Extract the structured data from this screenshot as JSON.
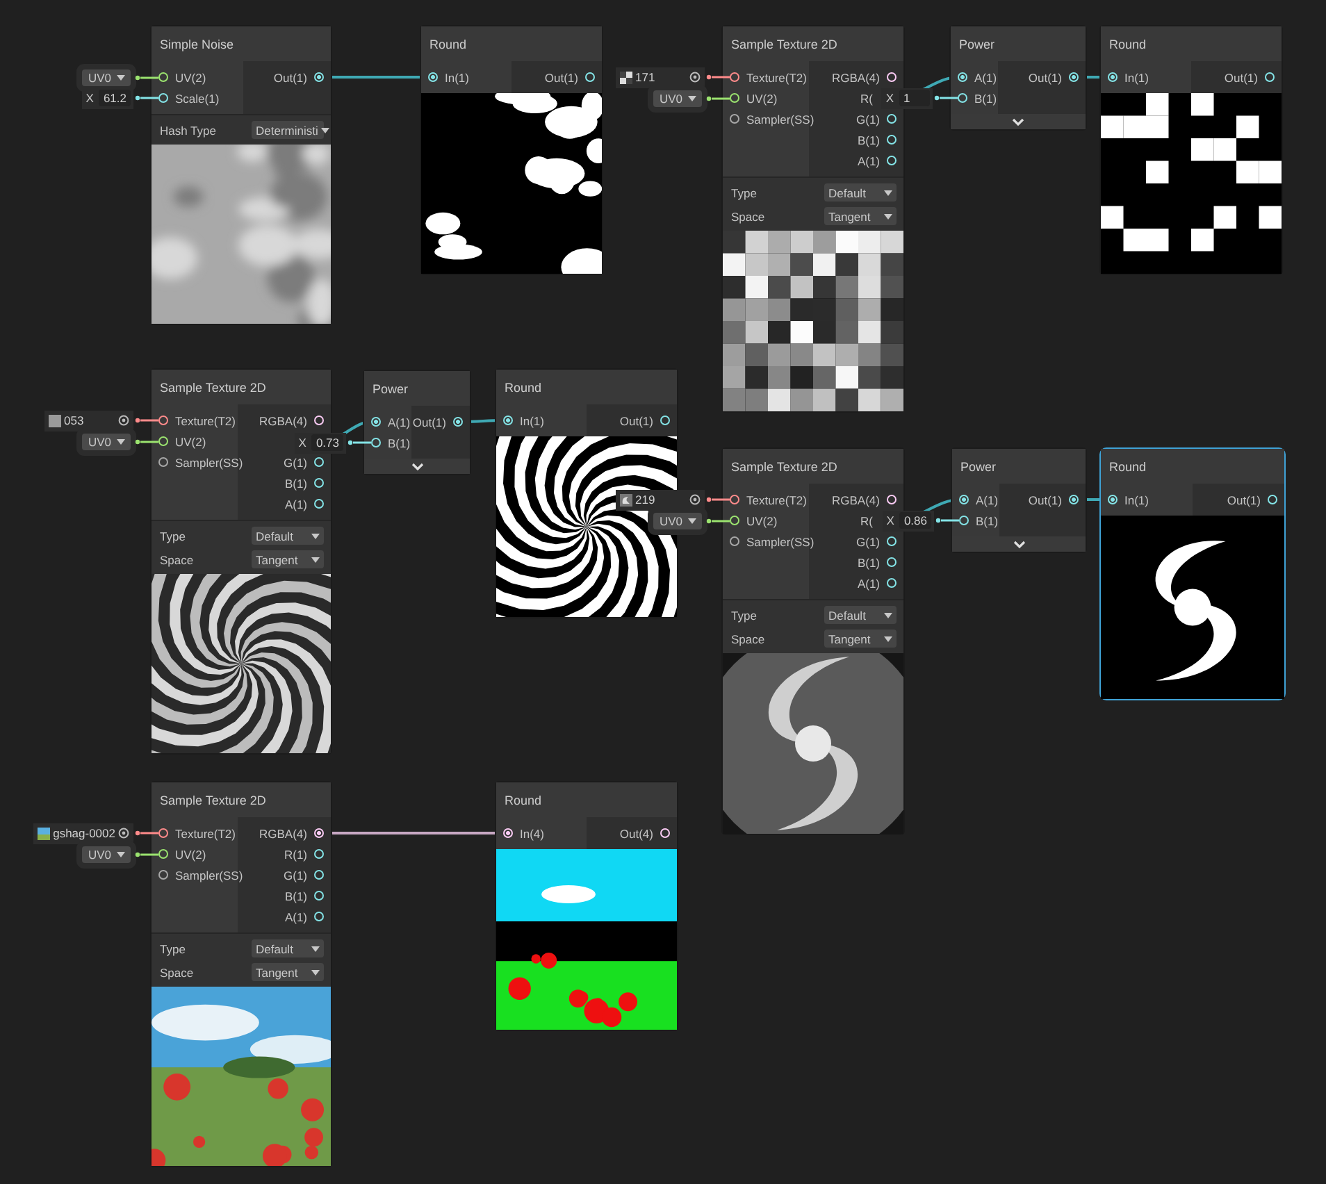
{
  "nodes": [
    {
      "kind": "noise",
      "title": "Simple Noise",
      "selected": false,
      "inputs": [
        {
          "label": "UV(2)",
          "color": "#9be36f",
          "connected": false,
          "field": {
            "kind": "dropdown",
            "value": "UV0"
          }
        },
        {
          "label": "Scale(1)",
          "color": "#84e4e7",
          "connected": false,
          "field": {
            "kind": "vector",
            "axis": "X",
            "value": "61.2"
          }
        }
      ],
      "outputs": [
        {
          "label": "Out(1)",
          "color": "#84e4e7",
          "connected": true
        }
      ],
      "settings": [
        {
          "label": "Hash Type",
          "value": "Deterministi"
        }
      ],
      "preview": {
        "kind": "picture"
      }
    },
    {
      "kind": "round",
      "title": "Round",
      "selected": false,
      "inputs": [
        {
          "label": "In(1)",
          "color": "#84e4e7",
          "connected": true
        }
      ],
      "outputs": [
        {
          "label": "Out(1)",
          "color": "#84e4e7",
          "connected": false
        }
      ],
      "preview": {
        "kind": "picture"
      }
    },
    {
      "kind": "sample",
      "title": "Sample Texture 2D",
      "selected": false,
      "inputs": [
        {
          "label": "Texture(T2)",
          "color": "#ff8b8b",
          "connected": false,
          "field": {
            "kind": "texture",
            "value": "171"
          }
        },
        {
          "label": "UV(2)",
          "color": "#9be36f",
          "connected": false,
          "field": {
            "kind": "dropdown",
            "value": "UV0"
          }
        },
        {
          "label": "Sampler(SS)",
          "color": "#a8a8a8",
          "connected": false
        }
      ],
      "outputs": [
        {
          "kind": "port",
          "label": "RGBA(4)",
          "color": "#fbcbf4",
          "connected": false
        },
        {
          "kind": "covered",
          "label": "R("
        },
        {
          "kind": "port",
          "label": "G(1)",
          "color": "#84e4e7",
          "connected": false
        },
        {
          "kind": "port",
          "label": "B(1)",
          "color": "#84e4e7",
          "connected": false
        },
        {
          "kind": "port",
          "label": "A(1)",
          "color": "#84e4e7",
          "connected": false
        }
      ],
      "settings": [
        {
          "label": "Type",
          "value": "Default"
        },
        {
          "label": "Space",
          "value": "Tangent"
        }
      ],
      "preview": {
        "kind": "picture"
      }
    },
    {
      "kind": "power",
      "title": "Power",
      "selected": false,
      "inputs": [
        {
          "label": "A(1)",
          "color": "#84e4e7",
          "connected": true
        },
        {
          "label": "B(1)",
          "color": "#84e4e7",
          "connected": false,
          "field": {
            "kind": "vector",
            "axis": "X",
            "value": "1"
          }
        }
      ],
      "outputs": [
        {
          "label": "Out(1)",
          "color": "#84e4e7",
          "connected": true
        }
      ],
      "expanded": false
    },
    {
      "kind": "round",
      "title": "Round",
      "selected": false,
      "inputs": [
        {
          "label": "In(1)",
          "color": "#84e4e7",
          "connected": true
        }
      ],
      "outputs": [
        {
          "label": "Out(1)",
          "color": "#84e4e7",
          "connected": false
        }
      ],
      "preview": {
        "kind": "picture"
      }
    },
    {
      "kind": "sample",
      "title": "Sample Texture 2D",
      "selected": false,
      "inputs": [
        {
          "label": "Texture(T2)",
          "color": "#ff8b8b",
          "connected": false,
          "field": {
            "kind": "texture",
            "value": "053"
          }
        },
        {
          "label": "UV(2)",
          "color": "#9be36f",
          "connected": false,
          "field": {
            "kind": "dropdown",
            "value": "UV0"
          }
        },
        {
          "label": "Sampler(SS)",
          "color": "#a8a8a8",
          "connected": false
        }
      ],
      "outputs": [
        {
          "kind": "port",
          "label": "RGBA(4)",
          "color": "#fbcbf4",
          "connected": false
        },
        {
          "kind": "covered"
        },
        {
          "kind": "port",
          "label": "G(1)",
          "color": "#84e4e7",
          "connected": false
        },
        {
          "kind": "port",
          "label": "B(1)",
          "color": "#84e4e7",
          "connected": false
        },
        {
          "kind": "port",
          "label": "A(1)",
          "color": "#84e4e7",
          "connected": false
        }
      ],
      "settings": [
        {
          "label": "Type",
          "value": "Default"
        },
        {
          "label": "Space",
          "value": "Tangent"
        }
      ],
      "preview": {
        "kind": "picture"
      }
    },
    {
      "kind": "power",
      "title": "Power",
      "selected": false,
      "inputs": [
        {
          "label": "A(1)",
          "color": "#84e4e7",
          "connected": true
        },
        {
          "label": "B(1)",
          "color": "#84e4e7",
          "connected": false,
          "field": {
            "kind": "vector",
            "axis": "X",
            "value": "0.73"
          }
        }
      ],
      "outputs": [
        {
          "label": "Out(1)",
          "color": "#84e4e7",
          "connected": true
        }
      ],
      "expanded": false
    },
    {
      "kind": "round",
      "title": "Round",
      "selected": false,
      "inputs": [
        {
          "label": "In(1)",
          "color": "#84e4e7",
          "connected": true
        }
      ],
      "outputs": [
        {
          "label": "Out(1)",
          "color": "#84e4e7",
          "connected": false
        }
      ],
      "preview": {
        "kind": "picture"
      }
    },
    {
      "kind": "sample",
      "title": "Sample Texture 2D",
      "selected": false,
      "inputs": [
        {
          "label": "Texture(T2)",
          "color": "#ff8b8b",
          "connected": false,
          "field": {
            "kind": "texture",
            "value": "219"
          }
        },
        {
          "label": "UV(2)",
          "color": "#9be36f",
          "connected": false,
          "field": {
            "kind": "dropdown",
            "value": "UV0"
          }
        },
        {
          "label": "Sampler(SS)",
          "color": "#a8a8a8",
          "connected": false
        }
      ],
      "outputs": [
        {
          "kind": "port",
          "label": "RGBA(4)",
          "color": "#fbcbf4",
          "connected": false
        },
        {
          "kind": "covered",
          "label": "R("
        },
        {
          "kind": "port",
          "label": "G(1)",
          "color": "#84e4e7",
          "connected": false
        },
        {
          "kind": "port",
          "label": "B(1)",
          "color": "#84e4e7",
          "connected": false
        },
        {
          "kind": "port",
          "label": "A(1)",
          "color": "#84e4e7",
          "connected": false
        }
      ],
      "settings": [
        {
          "label": "Type",
          "value": "Default"
        },
        {
          "label": "Space",
          "value": "Tangent"
        }
      ],
      "preview": {
        "kind": "picture"
      }
    },
    {
      "kind": "power",
      "title": "Power",
      "selected": false,
      "inputs": [
        {
          "label": "A(1)",
          "color": "#84e4e7",
          "connected": true
        },
        {
          "label": "B(1)",
          "color": "#84e4e7",
          "connected": false,
          "field": {
            "kind": "vector",
            "axis": "X",
            "value": "0.86"
          }
        }
      ],
      "outputs": [
        {
          "label": "Out(1)",
          "color": "#84e4e7",
          "connected": true
        }
      ],
      "expanded": false
    },
    {
      "kind": "round",
      "title": "Round",
      "selected": true,
      "inputs": [
        {
          "label": "In(1)",
          "color": "#84e4e7",
          "connected": true
        }
      ],
      "outputs": [
        {
          "label": "Out(1)",
          "color": "#84e4e7",
          "connected": false
        }
      ],
      "preview": {
        "kind": "picture"
      }
    },
    {
      "kind": "sample",
      "title": "Sample Texture 2D",
      "selected": false,
      "inputs": [
        {
          "label": "Texture(T2)",
          "color": "#ff8b8b",
          "connected": false,
          "field": {
            "kind": "texture",
            "value": "gshag-0002"
          }
        },
        {
          "label": "UV(2)",
          "color": "#9be36f",
          "connected": false,
          "field": {
            "kind": "dropdown",
            "value": "UV0"
          }
        },
        {
          "label": "Sampler(SS)",
          "color": "#a8a8a8",
          "connected": false
        }
      ],
      "outputs": [
        {
          "label": "RGBA(4)",
          "color": "#fbcbf4",
          "connected": true
        },
        {
          "label": "R(1)",
          "color": "#84e4e7",
          "connected": false
        },
        {
          "label": "G(1)",
          "color": "#84e4e7",
          "connected": false
        },
        {
          "label": "B(1)",
          "color": "#84e4e7",
          "connected": false
        },
        {
          "label": "A(1)",
          "color": "#84e4e7",
          "connected": false
        }
      ],
      "settings": [
        {
          "label": "Type",
          "value": "Default"
        },
        {
          "label": "Space",
          "value": "Tangent"
        }
      ],
      "preview": {
        "kind": "picture"
      }
    },
    {
      "kind": "round",
      "title": "Round",
      "selected": false,
      "inputs": [
        {
          "label": "In(4)",
          "color": "#fbcbf4",
          "connected": true
        }
      ],
      "outputs": [
        {
          "label": "Out(4)",
          "color": "#fbcbf4",
          "connected": false
        }
      ],
      "preview": {
        "kind": "picture"
      }
    }
  ]
}
